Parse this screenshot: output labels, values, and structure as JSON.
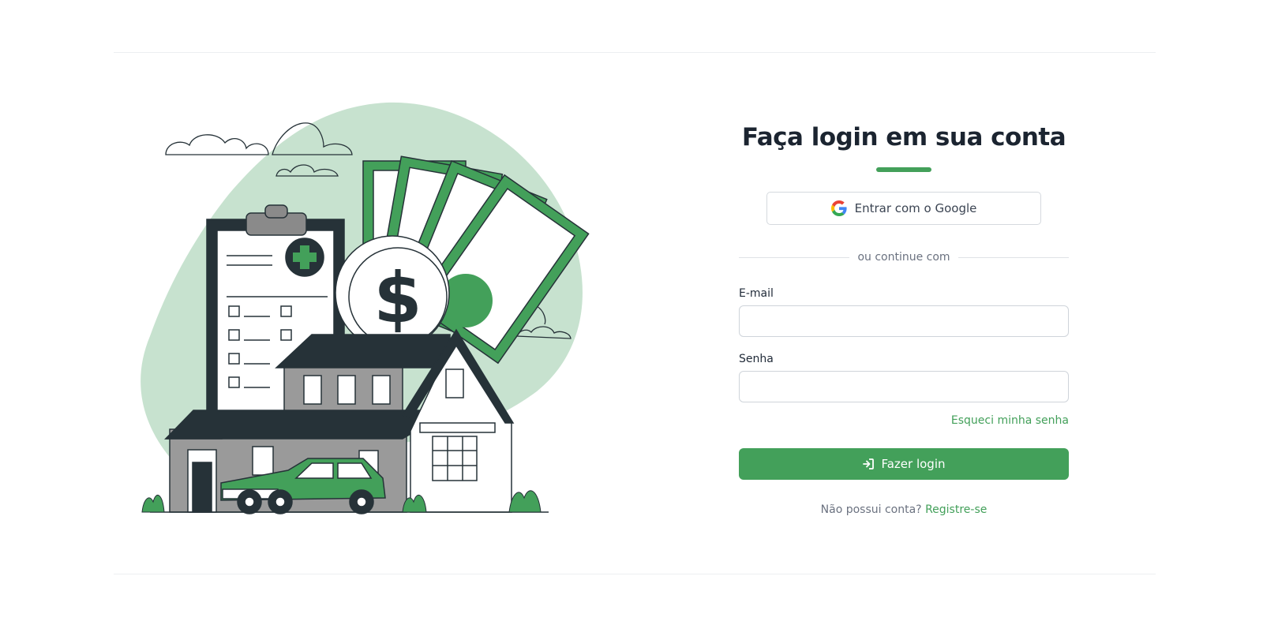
{
  "login": {
    "title": "Faça login em sua conta",
    "google_button": "Entrar com o Google",
    "divider_text": "ou continue com",
    "email_label": "E-mail",
    "email_value": "",
    "password_label": "Senha",
    "password_value": "",
    "forgot_link": "Esqueci minha senha",
    "submit_button": "Fazer login",
    "register_prompt": "Não possui conta?",
    "register_link": "Registre-se"
  },
  "icons": {
    "google": "google-icon",
    "submit": "sign-in-icon"
  },
  "colors": {
    "accent": "#43a05a",
    "illustration_blob": "#c7e2cf",
    "dark": "#263238"
  }
}
